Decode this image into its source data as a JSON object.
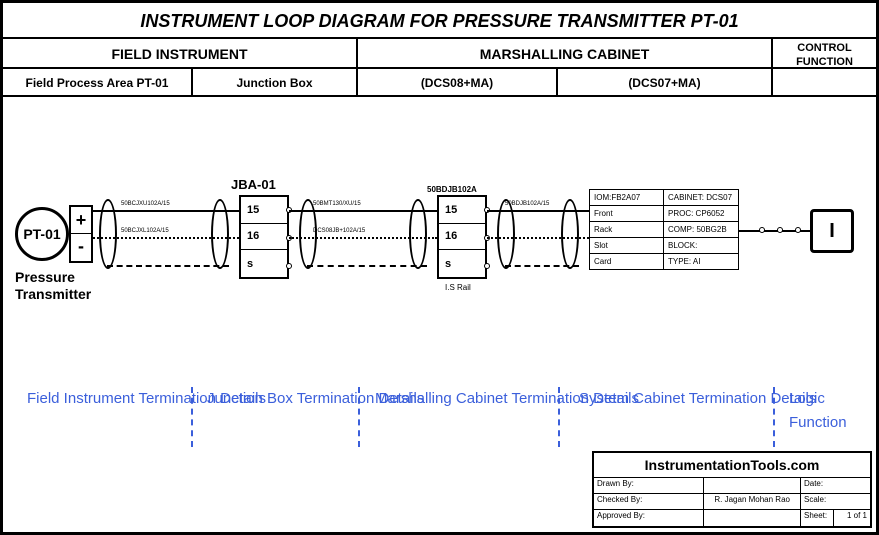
{
  "title": "INSTRUMENT LOOP DIAGRAM FOR PRESSURE TRANSMITTER PT-01",
  "header": {
    "field_instrument": "FIELD INSTRUMENT",
    "marshalling_cabinet": "MARSHALLING CABINET",
    "control_function": "CONTROL FUNCTION"
  },
  "subheader": {
    "field_process_area": "Field Process Area PT-01",
    "junction_box": "Junction Box",
    "dcs08": "(DCS08+MA)",
    "dcs07": "(DCS07+MA)"
  },
  "pt": {
    "tag": "PT-01",
    "plus": "+",
    "minus": "-",
    "label": "Pressure\nTransmitter"
  },
  "jb": {
    "label": "JBA-01",
    "t15": "15",
    "t16": "16",
    "ts": "s"
  },
  "mc": {
    "label": "50BDJB102A",
    "rail": "I.S Rail",
    "t15": "15",
    "t16": "16",
    "ts": "s"
  },
  "sys": {
    "rows": [
      {
        "l": "IOM:FB2A07",
        "r": "CABINET: DCS07"
      },
      {
        "l": "Front",
        "r": "PROC: CP6052"
      },
      {
        "l": "Rack",
        "r": "COMP: 50BG2B"
      },
      {
        "l": "Slot",
        "r": "BLOCK:"
      },
      {
        "l": "Card",
        "r": "TYPE: AI"
      }
    ]
  },
  "logic_symbol": "I",
  "sections": {
    "field": "Field Instrument\nTermination Details",
    "jb": "Junction Box\nTermination Details",
    "mc": "Marshalling Cabinet\nTermination Details",
    "sys": "System Cabinet\nTermination Details",
    "logic": "Logic\nFunction"
  },
  "titleblock": {
    "site": "InstrumentationTools.com",
    "drawn_by": "Drawn By:",
    "drawn_by_val": "",
    "date": "Date:",
    "checked_by": "Checked By:",
    "checked_by_val": "R. Jagan Mohan Rao",
    "scale": "Scale:",
    "approved_by": "Approved By:",
    "sheet": "Sheet:",
    "sheet_val": "1 of 1"
  }
}
